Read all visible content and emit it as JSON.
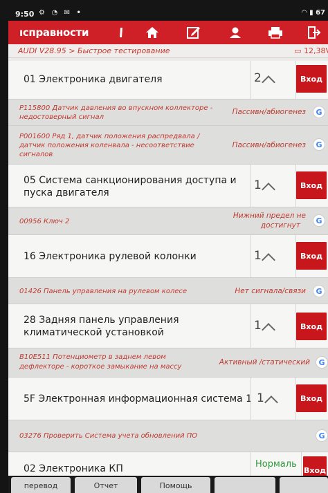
{
  "status_bar": {
    "time": "9:50",
    "battery": "67"
  },
  "header": {
    "title": "ıсправности"
  },
  "breadcrumb": {
    "path": "AUDI V28.95 > Быстрое тестирование",
    "voltage": "12,38V"
  },
  "go_label": "Вход",
  "systems": [
    {
      "name_line1": "01 Электроника двигателя",
      "name_line2": "",
      "count": "2"
    },
    {
      "name_line1": "05 Система санкционирования доступа и",
      "name_line2": "пуска двигателя",
      "count": "1"
    },
    {
      "name_line1": "16 Электроника рулевой колонки",
      "name_line2": "",
      "count": "1"
    },
    {
      "name_line1": "28 Задняя панель управления",
      "name_line2": "климатической установкой",
      "count": "1"
    },
    {
      "name_line1": "5F Электронная информационная система 1",
      "name_line2": "",
      "count": "1"
    },
    {
      "name_line1": "02 Электроника КП",
      "name_line2": "",
      "count": ""
    }
  ],
  "system6_status": "Нормаль",
  "dtcs": [
    {
      "line1": "P115800 Датчик давления во впускном коллекторе -",
      "line2": "недостоверный сигнал",
      "line3": "",
      "status1": "Пассивн/абиогенез",
      "status2": ""
    },
    {
      "line1": "P001600 Ряд 1, датчик положения распредвала /",
      "line2": "датчик положения коленвала - несоответствие",
      "line3": "сигналов",
      "status1": "Пассивн/абиогенез",
      "status2": ""
    },
    {
      "line1": "00956 Ключ 2",
      "line2": "",
      "line3": "",
      "status1": "Нижний предел не",
      "status2": "достигнут"
    },
    {
      "line1": "01426 Панель управления на рулевом колесе",
      "line2": "",
      "line3": "",
      "status1": "Нет сигнала/связи",
      "status2": ""
    },
    {
      "line1": "B10E511 Потенциометр в заднем левом",
      "line2": "дефлекторе - короткое замыкание на массу",
      "line3": "",
      "status1": "Активный /статический",
      "status2": ""
    },
    {
      "line1": "03276 Проверить Система учета обновлений ПО",
      "line2": "",
      "line3": "",
      "status1": "",
      "status2": ""
    }
  ],
  "google_glyph": "G",
  "tabs": [
    "перевод",
    "Отчет",
    "Помощь",
    "",
    ""
  ]
}
